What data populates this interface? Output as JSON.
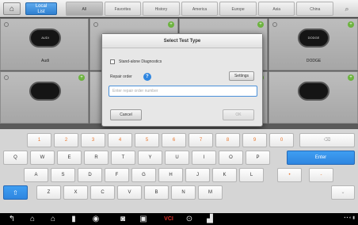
{
  "topbar": {
    "local_label": "Local\nList",
    "tabs": [
      "All",
      "Favorites",
      "History",
      "America",
      "Europe",
      "Asia",
      "China"
    ],
    "active_tab": "All"
  },
  "grid": {
    "brands": [
      "Audi",
      "",
      "",
      "DODGE"
    ]
  },
  "dialog": {
    "title": "Select Test Type",
    "standalone_label": "Stand-alone Diagnostics",
    "repair_order_label": "Repair order",
    "settings_label": "Settings",
    "repair_placeholder": "Enter repair order number",
    "cancel_label": "Cancel",
    "ok_label": "OK"
  },
  "keyboard": {
    "row1": [
      "1",
      "2",
      "3",
      "4",
      "5",
      "6",
      "7",
      "8",
      "9",
      "0"
    ],
    "row2": [
      "Q",
      "W",
      "E",
      "R",
      "T",
      "Y",
      "U",
      "I",
      "O",
      "P"
    ],
    "row3": [
      "A",
      "S",
      "D",
      "F",
      "G",
      "H",
      "J",
      "K",
      "L",
      "•",
      "-"
    ],
    "row4": [
      "Z",
      "X",
      "C",
      "V",
      "B",
      "N",
      "M"
    ],
    "enter_label": "Enter"
  },
  "navbar": {
    "vci_label": "VCI"
  },
  "colors": {
    "accent": "#2f86e0",
    "number_key": "#e8742a",
    "vci_red": "#e0302a"
  }
}
